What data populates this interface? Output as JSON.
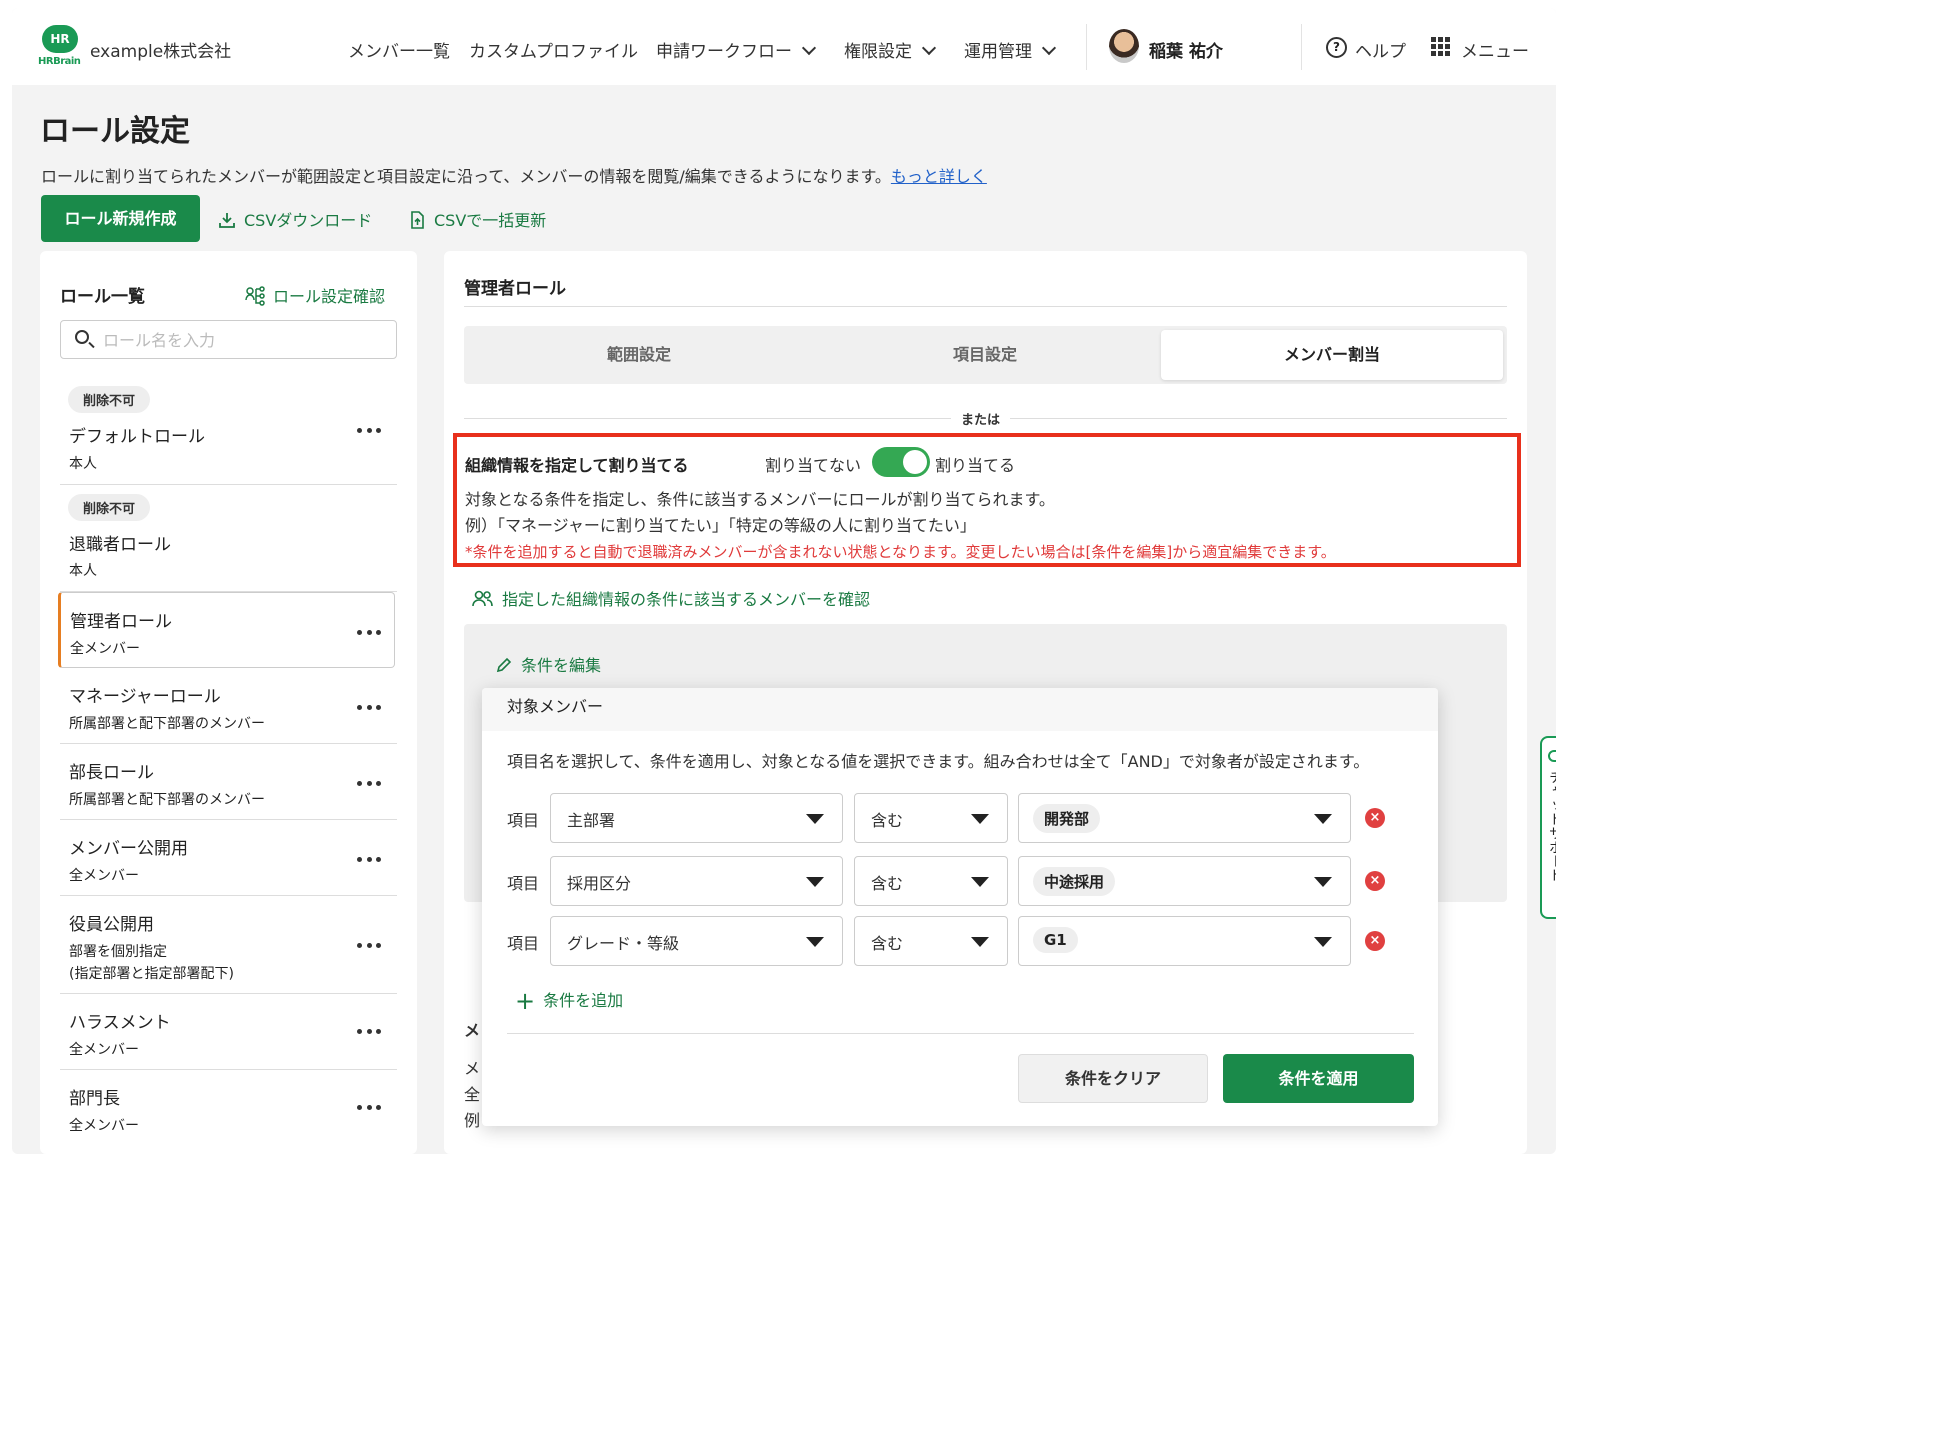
{
  "header": {
    "logo_text": "HR",
    "logo_sub": "HRBrain",
    "company": "example株式会社",
    "nav": [
      {
        "label": "メンバー一覧"
      },
      {
        "label": "カスタムプロファイル"
      },
      {
        "label": "申請ワークフロー"
      },
      {
        "label": "権限設定"
      },
      {
        "label": "運用管理"
      }
    ],
    "user_name": "稲葉 祐介",
    "help_label": "ヘルプ",
    "menu_label": "メニュー"
  },
  "page": {
    "title": "ロール設定",
    "description": "ロールに割り当てられたメンバーが範囲設定と項目設定に沿って、メンバーの情報を閲覧/編集できるようになります。",
    "more_link": "もっと詳しく",
    "new_role_button": "ロール新規作成",
    "csv_download": "CSVダウンロード",
    "csv_bulk_update": "CSVで一括更新"
  },
  "role_list": {
    "title": "ロール一覧",
    "check_link": "ロール設定確認",
    "search_placeholder": "ロール名を入力",
    "items": [
      {
        "badge": "削除不可",
        "name": "デフォルトロール",
        "sub": "本人"
      },
      {
        "badge": "削除不可",
        "name": "退職者ロール",
        "sub": "本人"
      },
      {
        "name": "管理者ロール",
        "sub": "全メンバー"
      },
      {
        "name": "マネージャーロール",
        "sub": "所属部署と配下部署のメンバー"
      },
      {
        "name": "部長ロール",
        "sub": "所属部署と配下部署のメンバー"
      },
      {
        "name": "メンバー公開用",
        "sub": "全メンバー"
      },
      {
        "name": "役員公開用",
        "sub": "部署を個別指定",
        "sub2": "(指定部署と指定部署配下)"
      },
      {
        "name": "ハラスメント",
        "sub": "全メンバー"
      },
      {
        "name": "部門長",
        "sub": "全メンバー"
      }
    ]
  },
  "detail": {
    "title": "管理者ロール",
    "tabs": [
      "範囲設定",
      "項目設定",
      "メンバー割当"
    ],
    "or_label": "または",
    "org_title": "組織情報を指定して割り当てる",
    "toggle_off_label": "割り当てない",
    "toggle_on_label": "割り当てる",
    "toggle_value": true,
    "desc1": "対象となる条件を指定し、条件に該当するメンバーにロールが割り当てられます。",
    "desc2": "例）「マネージャーに割り当てたい」「特定の等級の人に割り当てたい」",
    "warning": "*条件を追加すると自動で退職済みメンバーが含まれない状態となります。変更したい場合は[条件を編集]から適宜編集できます。",
    "check_members_link": "指定した組織情報の条件に該当するメンバーを確認",
    "edit_conditions_link": "条件を編集",
    "peek_1": "メ",
    "peek_2": "メ",
    "peek_3": "全",
    "peek_4": "例"
  },
  "modal": {
    "title": "対象メンバー",
    "description": "項目名を選択して、条件を適用し、対象となる値を選択できます。組み合わせは全て「AND」で対象者が設定されます。",
    "row_label": "項目",
    "conditions": [
      {
        "field": "主部署",
        "op": "含む",
        "value": "開発部"
      },
      {
        "field": "採用区分",
        "op": "含む",
        "value": "中途採用"
      },
      {
        "field": "グレード・等級",
        "op": "含む",
        "value": "G1"
      }
    ],
    "add_condition": "条件を追加",
    "clear_button": "条件をクリア",
    "apply_button": "条件を適用"
  },
  "chat_support": {
    "label": "チャットサポート"
  },
  "colors": {
    "brand": "#1a8a4a",
    "highlight": "#e8301c",
    "warning": "#e03a3a",
    "link": "#2161c9"
  }
}
